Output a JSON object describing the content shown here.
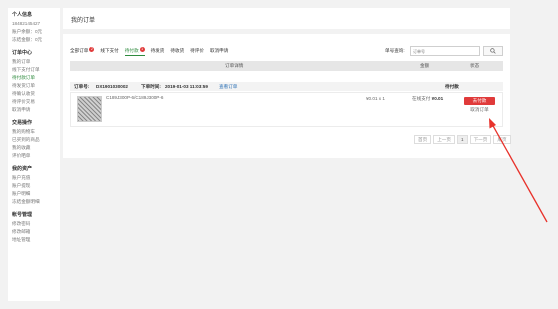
{
  "sidebar": {
    "groups": [
      {
        "title": "个人信息",
        "items": [
          "18482145427",
          "账户余额：0元",
          "冻结金额：0元"
        ]
      },
      {
        "title": "订单中心",
        "items": [
          "我的订单",
          "线下支付订单",
          "待付款订单",
          "待发货订单",
          "待确认收货",
          "待评价交易",
          "取消申请"
        ]
      },
      {
        "title": "交易操作",
        "items": [
          "我的购物车",
          "已买到的商品",
          "我的收藏",
          "评价晒单"
        ]
      },
      {
        "title": "我的资产",
        "items": [
          "账户充值",
          "账户提现",
          "账户明细",
          "冻结金额明细"
        ]
      },
      {
        "title": "帐号管理",
        "items": [
          "修改密码",
          "修改邮箱",
          "地址管理"
        ]
      }
    ],
    "active_item": "待付款订单"
  },
  "page": {
    "title": "我的订单"
  },
  "tabs": [
    {
      "label": "全部订单",
      "badge": "2"
    },
    {
      "label": "线下支付",
      "badge": ""
    },
    {
      "label": "待付款",
      "badge": "1"
    },
    {
      "label": "待发货",
      "badge": ""
    },
    {
      "label": "待收货",
      "badge": ""
    },
    {
      "label": "待评价",
      "badge": ""
    },
    {
      "label": "取消申请",
      "badge": ""
    }
  ],
  "active_tab": "待付款",
  "search": {
    "label": "单号查询:",
    "placeholder": "订单号",
    "button_icon": "search-icon"
  },
  "table": {
    "headers": {
      "detail": "订单详情",
      "amount": "金额",
      "status": "状态"
    }
  },
  "order": {
    "no_label": "订单号:",
    "no": "DX1901030002",
    "time_label": "下单时间:",
    "time": "2019-01-03 11:03:59",
    "detail_link": "查看订单",
    "status": "待付款",
    "item_name": "C189J300P-6/C189J300P-6",
    "item_price": "¥0.01 x 1",
    "total_label": "在线支付",
    "total": "¥0.01",
    "pay_button": "去付款",
    "cancel_link": "取消订单"
  },
  "pager": {
    "first": "首页",
    "prev": "上一页",
    "current": "1",
    "next": "下一页",
    "last": "尾页"
  },
  "colors": {
    "accent": "#2e8b3e",
    "danger": "#e03a3a",
    "annotation_arrow": "#e8322b"
  }
}
